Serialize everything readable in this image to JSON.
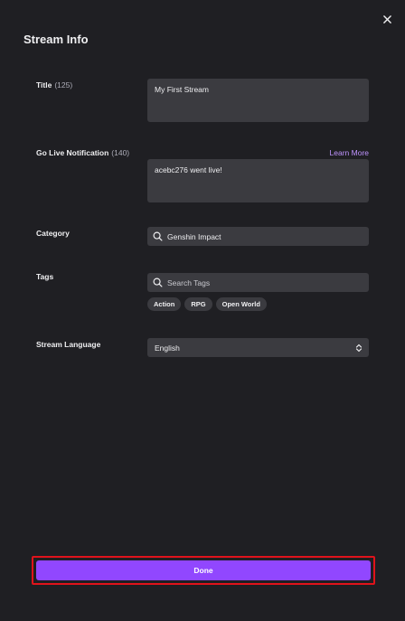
{
  "dialog": {
    "title": "Stream Info",
    "close_icon": "close-icon"
  },
  "title_field": {
    "label": "Title",
    "count": "(125)",
    "value": "My First Stream"
  },
  "notification_field": {
    "label": "Go Live Notification",
    "count": "(140)",
    "learn_more": "Learn More",
    "value": "acebc276 went live!"
  },
  "category_field": {
    "label": "Category",
    "value": "Genshin Impact",
    "icon": "search-icon"
  },
  "tags_field": {
    "label": "Tags",
    "placeholder": "Search Tags",
    "icon": "search-icon",
    "tags": [
      "Action",
      "RPG",
      "Open World"
    ]
  },
  "language_field": {
    "label": "Stream Language",
    "value": "English",
    "icon": "chevron-up-down-icon"
  },
  "footer": {
    "done_label": "Done"
  },
  "colors": {
    "accent": "#9147ff",
    "link": "#bf94ff",
    "highlight_border": "#e0131b",
    "panel_bg": "#1f1f23",
    "field_bg": "#3b3b40"
  }
}
